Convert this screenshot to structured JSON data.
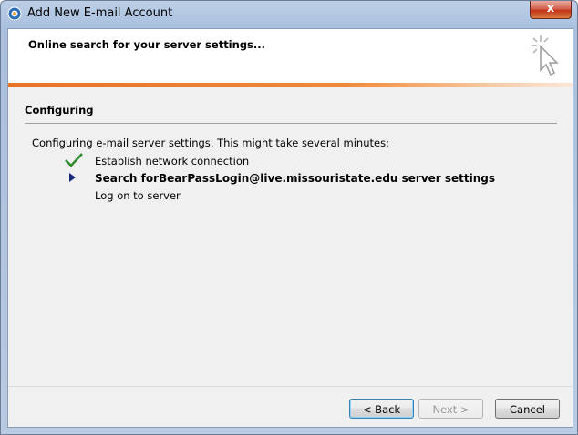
{
  "window": {
    "title": "Add New E-mail Account",
    "close_glyph": "x"
  },
  "header": {
    "title": "Online search for your server settings...",
    "icon": "wizard-cursor-icon"
  },
  "colors": {
    "accent_bar": "#e8732a",
    "check": "#2e8b2e",
    "arrow": "#1a2a7a"
  },
  "section": {
    "title": "Configuring",
    "message": "Configuring e-mail server settings. This might take several minutes:"
  },
  "steps": [
    {
      "label": "Establish network connection",
      "status": "done",
      "icon": "checkmark-icon"
    },
    {
      "label": "Search forBearPassLogin@live.missouristate.edu server settings",
      "status": "in-progress",
      "icon": "current-step-arrow-icon"
    },
    {
      "label": "Log on to server",
      "status": "pending"
    }
  ],
  "buttons": {
    "back": "< Back",
    "next": "Next >",
    "cancel": "Cancel"
  }
}
